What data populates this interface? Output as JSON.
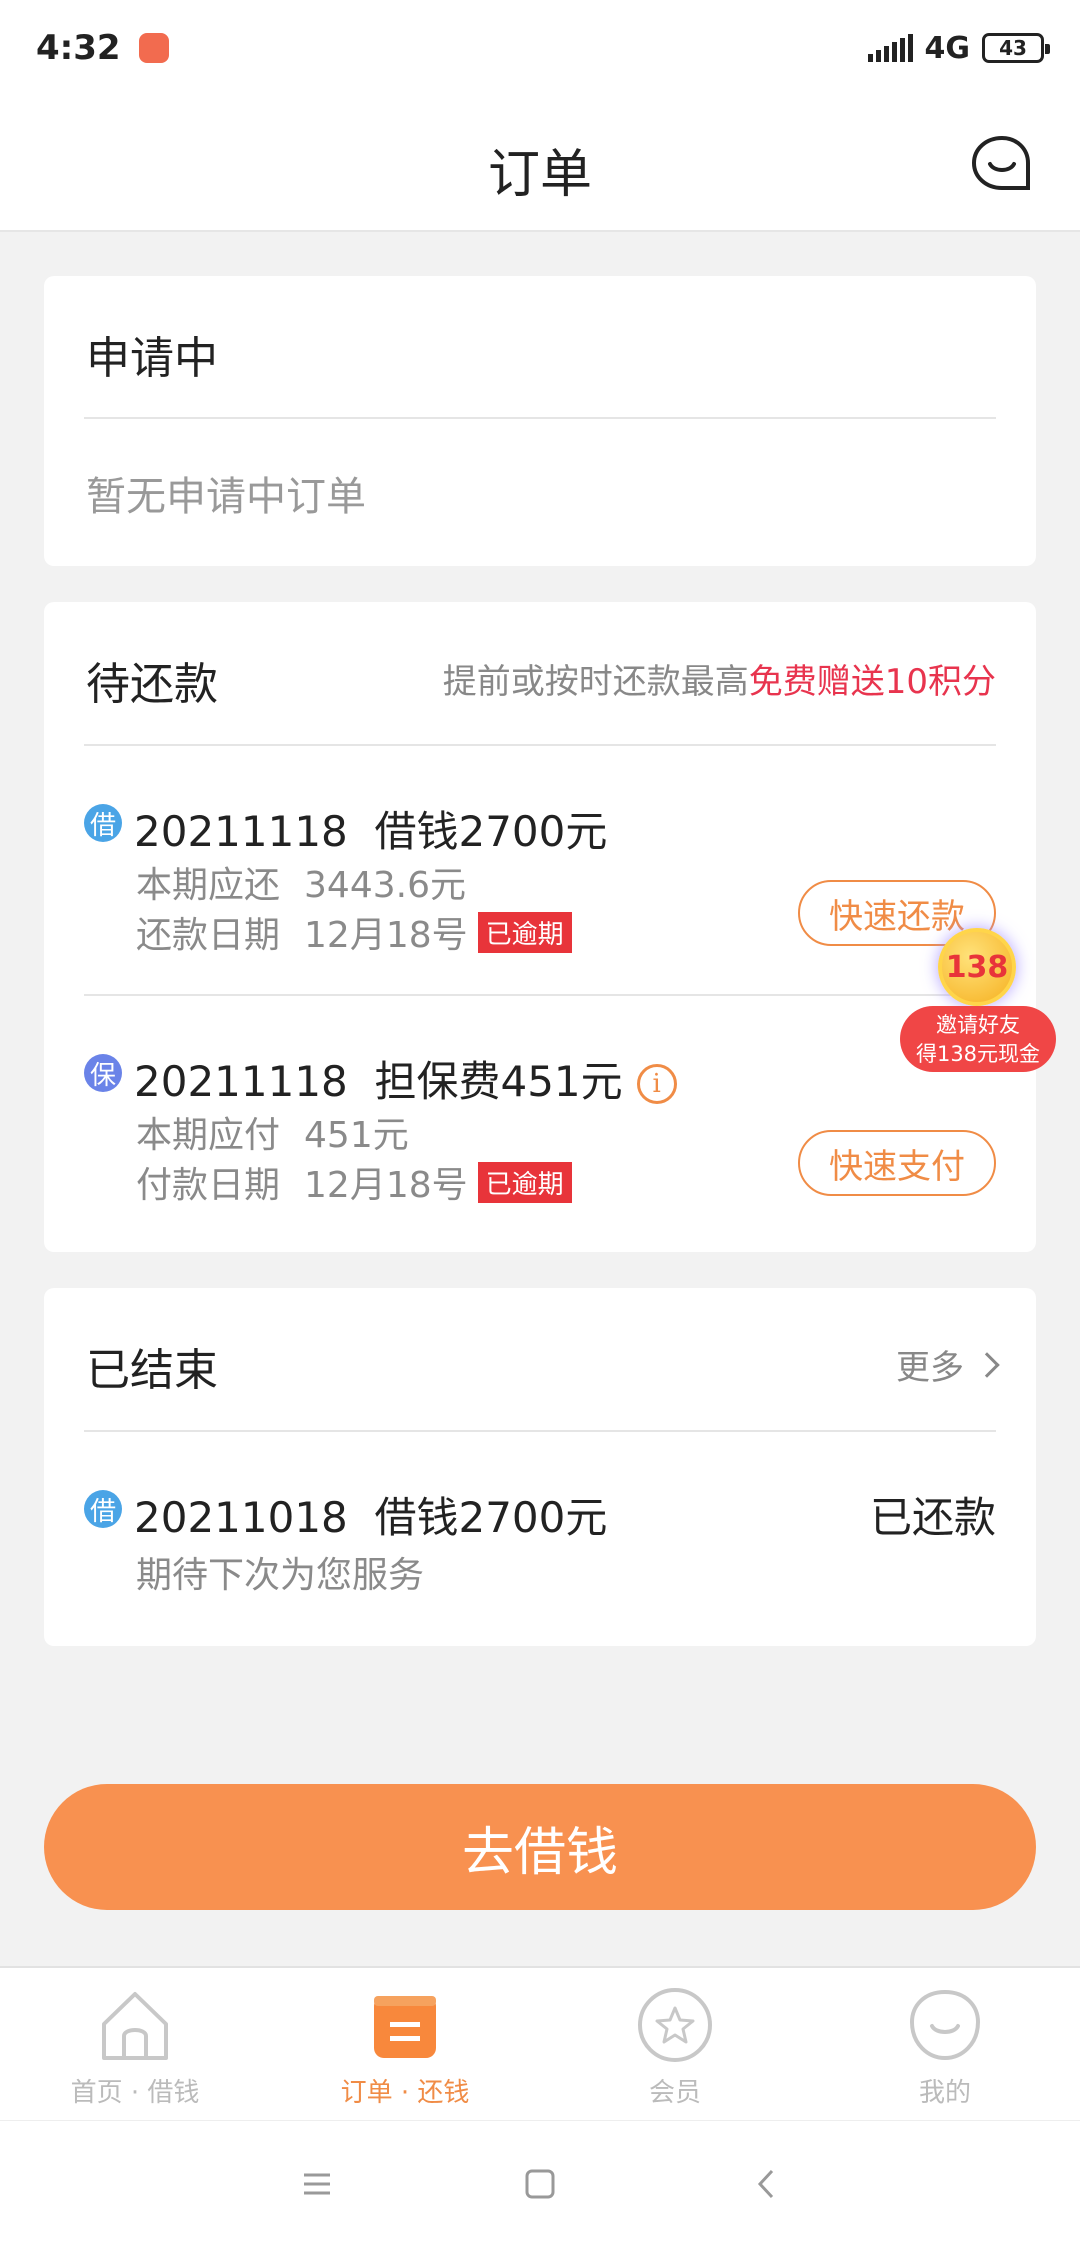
{
  "status_bar": {
    "time": "4:32",
    "network": "4G",
    "battery": "43"
  },
  "header": {
    "title": "订单"
  },
  "applying": {
    "title": "申请中",
    "empty_text": "暂无申请中订单"
  },
  "pending": {
    "title": "待还款",
    "promo_prefix": "提前或按时还款最高",
    "promo_highlight": "免费赠送10积分",
    "orders": [
      {
        "tag": "借",
        "id": "20211118",
        "desc": "借钱2700元",
        "line1_label": "本期应还",
        "line1_value": "3443.6元",
        "line2_label": "还款日期",
        "line2_value": "12月18号",
        "overdue": "已逾期",
        "button": "快速还款"
      },
      {
        "tag": "保",
        "id": "20211118",
        "desc": "担保费451元",
        "info": "i",
        "line1_label": "本期应付",
        "line1_value": "451元",
        "line2_label": "付款日期",
        "line2_value": "12月18号",
        "overdue": "已逾期",
        "button": "快速支付"
      }
    ]
  },
  "finished": {
    "title": "已结束",
    "more": "更多",
    "order": {
      "tag": "借",
      "id": "20211018",
      "desc": "借钱2700元",
      "status": "已还款",
      "note": "期待下次为您服务"
    }
  },
  "promo_badge": {
    "amount": "138",
    "line1": "邀请好友",
    "line2": "得138元现金"
  },
  "borrow_button": "去借钱",
  "bottom_nav": [
    {
      "label": "首页 · 借钱",
      "icon": "house-icon"
    },
    {
      "label": "订单 · 还钱",
      "icon": "orders-icon"
    },
    {
      "label": "会员",
      "icon": "star-icon"
    },
    {
      "label": "我的",
      "icon": "profile-icon"
    }
  ],
  "colors": {
    "accent": "#f08c46",
    "button": "#f89150",
    "highlight": "#e8344e",
    "overdue": "#e8343a"
  }
}
